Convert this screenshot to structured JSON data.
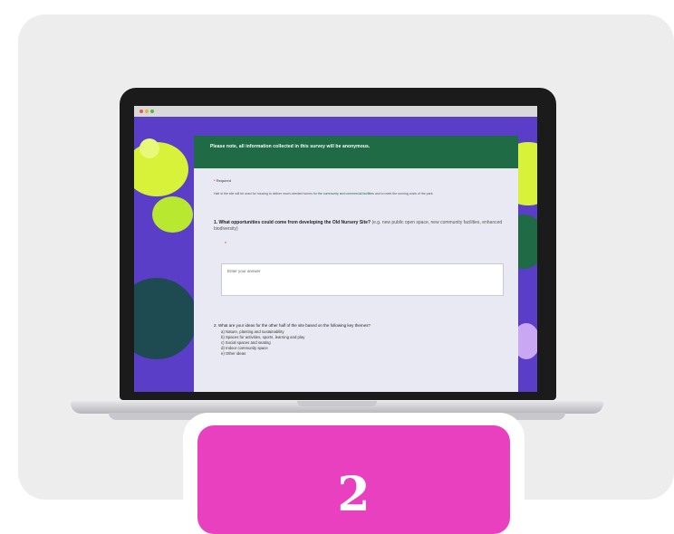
{
  "form": {
    "header_text": "Please note, all information collected in this survey will be anonymous.",
    "required_marker": "*",
    "required_label": "Required",
    "intro_text_a": "Half of the site will be used for housing to deliver much-needed homes",
    "intro_highlight": "for the community and commercial facilities",
    "intro_text_b": "and to meet the running costs of the park.",
    "q1_text": "1. What opportunities could come from developing the Old Nursery Site?",
    "q1_hint": "(e.g. new public open space, new community facilities, enhanced biodiversity)",
    "q1_star": "*",
    "answer_placeholder": "Enter your answer",
    "q2_text": "2. What are your ideas for the other half of the site based on the following key themes?",
    "q2_items": [
      "a) Nature, planting and sustainability",
      "b) Spaces for activities, sports, learning and play",
      "c) Social spaces and seating",
      "d) Indoor community space",
      "e) Other ideas"
    ]
  },
  "badge": {
    "number": "2"
  },
  "colors": {
    "screen_bg": "#5b3ec8",
    "header": "#1f6b45",
    "lime": "#d8f23a",
    "badge": "#e940c0"
  },
  "icons": [
    "browser-chrome-dots"
  ]
}
